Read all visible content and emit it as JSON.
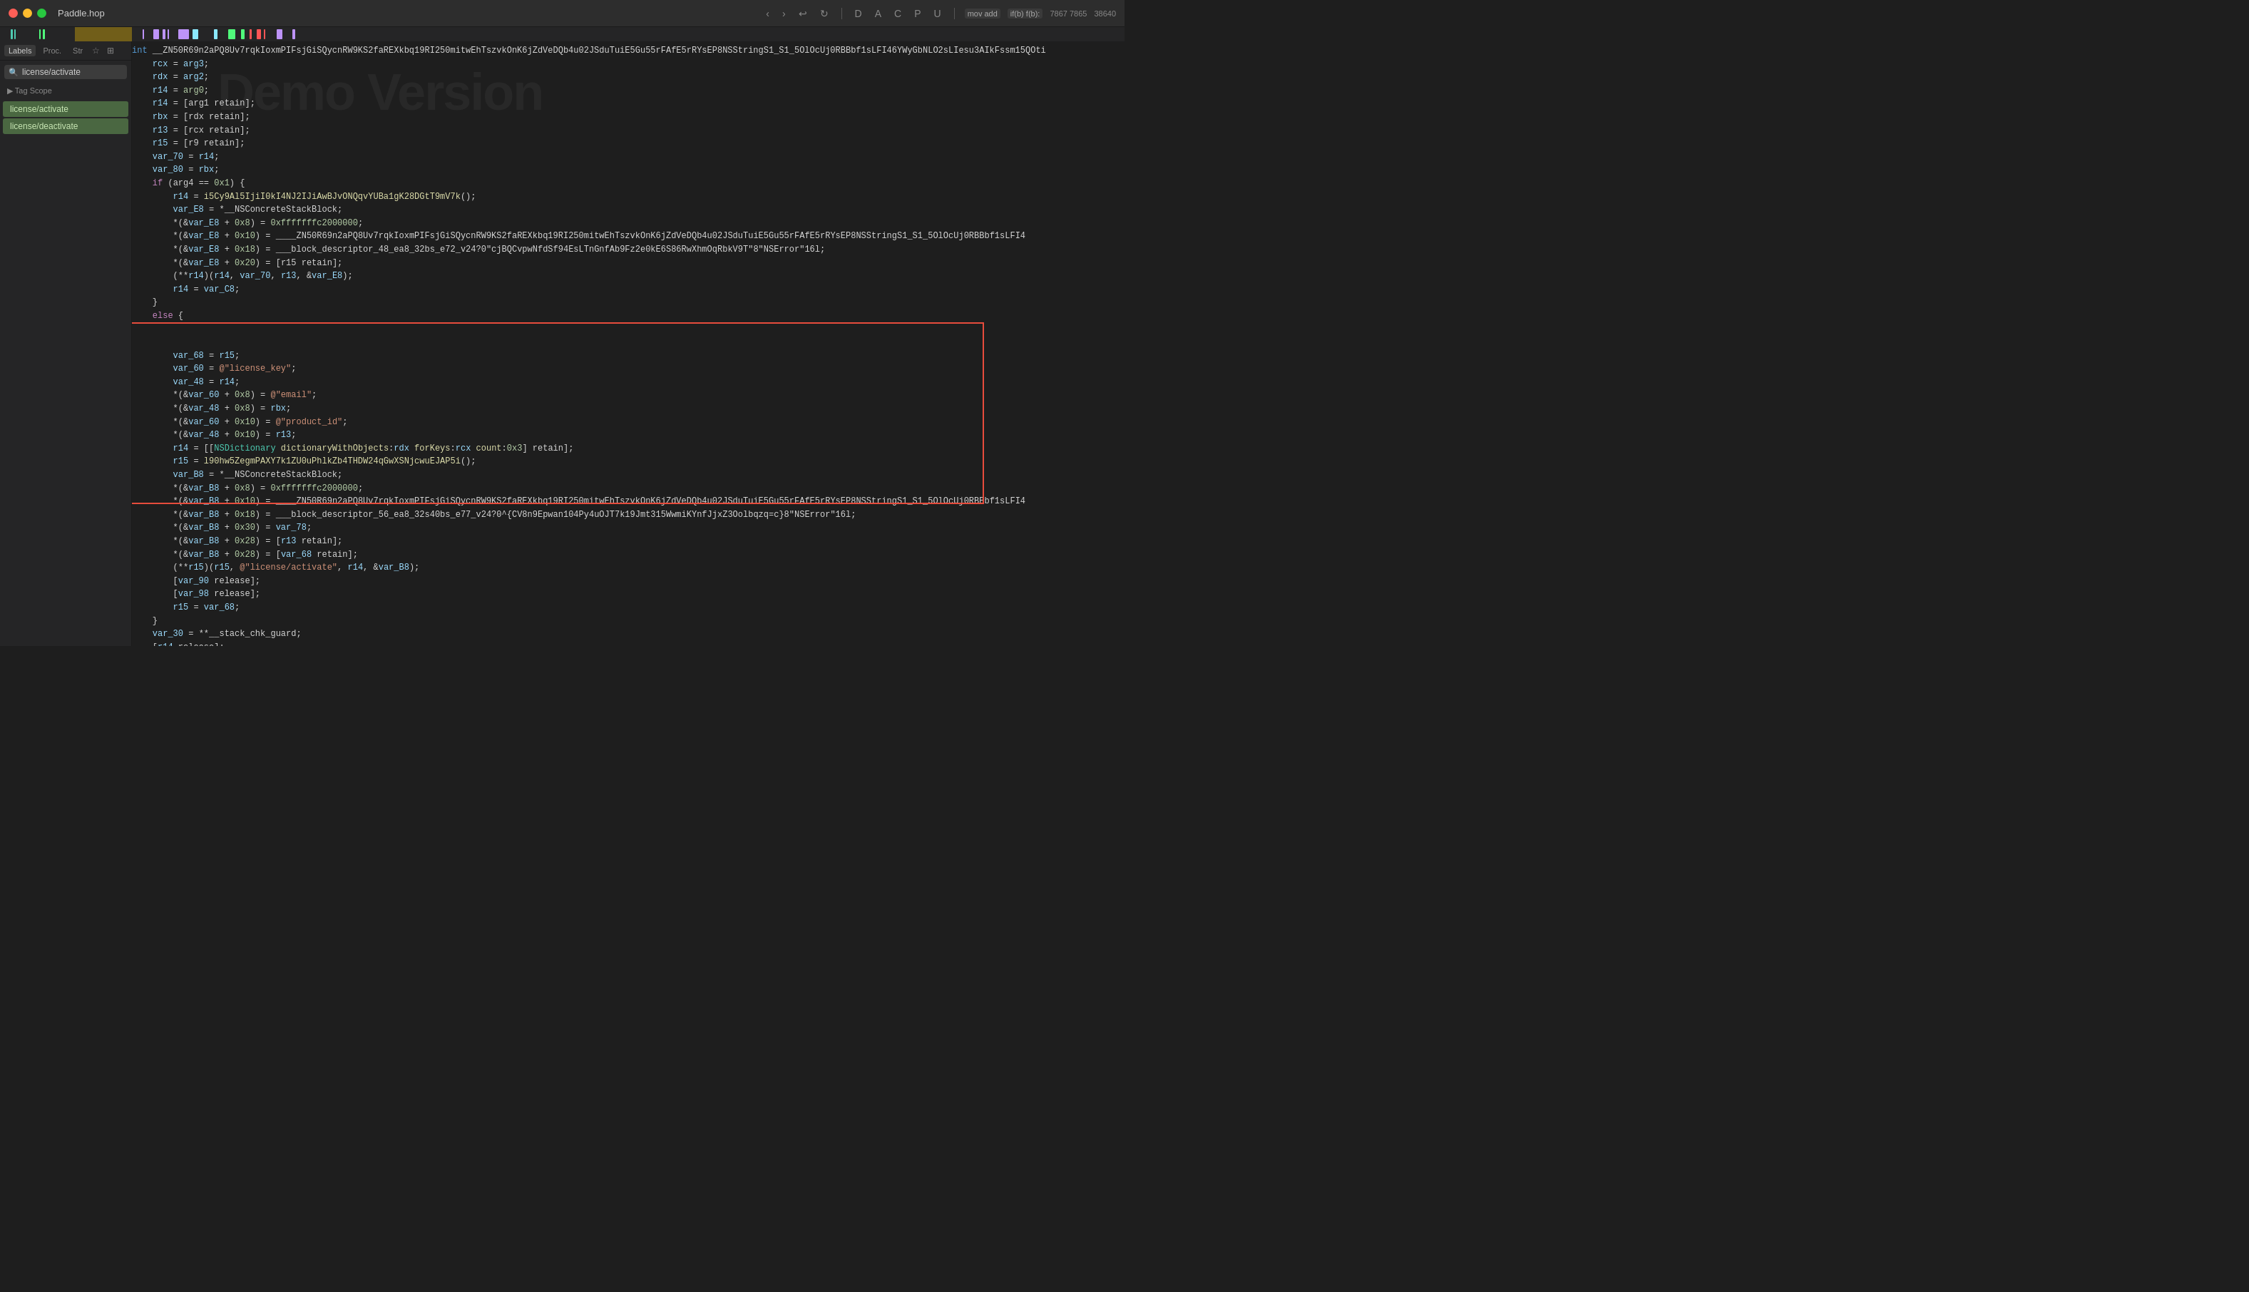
{
  "titlebar": {
    "title": "Paddle.hop",
    "nav_back": "‹",
    "nav_fwd": "›",
    "undo": "↩",
    "refresh": "↻",
    "btn_d": "D",
    "btn_a": "A",
    "btn_c": "C",
    "btn_p": "P",
    "btn_u": "U",
    "label_mov": "mov add",
    "label_ifb": "if(b) f(b):",
    "label_num1": "7867 7865",
    "label_num2": "38640"
  },
  "sidebar": {
    "tabs": [
      "Labels",
      "Proc.",
      "Str"
    ],
    "search_placeholder": "license/activate",
    "tag_scope": "Tag Scope",
    "items": [
      {
        "label": "license/activate",
        "active": true
      },
      {
        "label": "license/deactivate",
        "active": true
      }
    ]
  },
  "header_code": "int __ZN50R69n2aPQ8Uv7rqkIoxmPIFsjGiSQycnRW9KS2faREXkbq19RI250mitwEhTszvkOnK6jZdVeDQb4u02JSduTuiE5Gu55rFAfE5rRYsEP8NSStringS1_S1_5OlOcUj0RBBbf1sLFI46YWyGbNLO2sLIesu3AIkFssm15QOti"
}
